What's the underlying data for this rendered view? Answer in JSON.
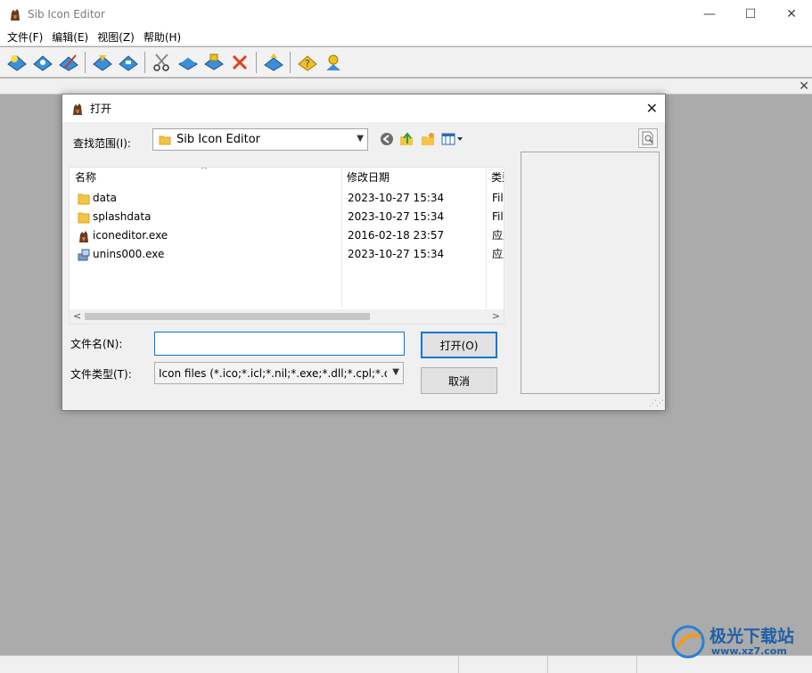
{
  "app": {
    "title": "Sib Icon Editor"
  },
  "window_controls": {
    "minimize": "—",
    "maximize": "☐",
    "close": "✕"
  },
  "menu": [
    "文件(F)",
    "编辑(E)",
    "视图(Z)",
    "帮助(H)"
  ],
  "toolbar": {
    "groups": [
      [
        "new-icon",
        "open-icon",
        "wand-icon"
      ],
      [
        "save-icon",
        "save-as-icon"
      ],
      [
        "cut-icon",
        "copy-icon",
        "paste-icon",
        "delete-icon"
      ],
      [
        "export-icon"
      ],
      [
        "help-icon",
        "about-icon"
      ]
    ]
  },
  "strip": {
    "close": "✕"
  },
  "dialog": {
    "title": "打开",
    "close": "✕",
    "look_in_label": "查找范围(I):",
    "look_in_value": "Sib Icon Editor",
    "columns": {
      "name": "名称",
      "date": "修改日期",
      "type": "类型"
    },
    "files": [
      {
        "name": "data",
        "date": "2023-10-27 15:34",
        "type": "File folder",
        "icon": "folder-icon"
      },
      {
        "name": "splashdata",
        "date": "2023-10-27 15:34",
        "type": "File folder",
        "icon": "folder-icon"
      },
      {
        "name": "iconeditor.exe",
        "date": "2016-02-18 23:57",
        "type": "应用程序",
        "icon": "app-icon"
      },
      {
        "name": "unins000.exe",
        "date": "2023-10-27 15:34",
        "type": "应用程序",
        "icon": "installer-icon"
      }
    ],
    "file_name_label": "文件名(N):",
    "file_name_value": "",
    "file_type_label": "文件类型(T):",
    "file_type_value": "Icon files (*.ico;*.icl;*.nil;*.exe;*.dll;*.cpl;*.ocx;*",
    "open_button": "打开(O)",
    "cancel_button": "取消"
  },
  "watermark": {
    "text": "极光下载站",
    "url": "www.xz7.com"
  },
  "colors": {
    "accent": "#0078d7",
    "mdi_background": "#ababab",
    "folder": "#f5c445"
  }
}
